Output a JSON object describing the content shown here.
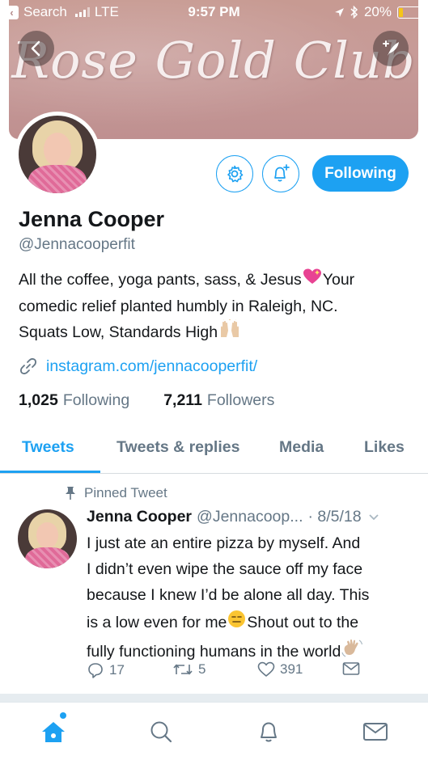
{
  "status_bar": {
    "back_app": "Search",
    "carrier": "LTE",
    "time": "9:57 PM",
    "battery": "20%",
    "battery_level": 0.2
  },
  "header": {
    "banner_text": "Rose Gold Club",
    "back_icon": "chevron-left-icon",
    "compose_icon": "compose-tweet-icon"
  },
  "profile": {
    "name": "Jenna Cooper",
    "handle": "@Jennacooperfit",
    "bio_line1_a": "All the coffee, yoga pants, sass, & Jesus",
    "bio_line1_b": "Your",
    "bio_line2": "comedic relief planted humbly in Raleigh, NC.",
    "bio_line3": "Squats Low, Standards High",
    "website": "instagram.com/jennacooperfit/",
    "following_count": "1,025",
    "following_label": "Following",
    "followers_count": "7,211",
    "followers_label": "Followers",
    "follow_button": "Following"
  },
  "tabs": [
    {
      "label": "Tweets",
      "active": true
    },
    {
      "label": "Tweets & replies",
      "active": false
    },
    {
      "label": "Media",
      "active": false
    },
    {
      "label": "Likes",
      "active": false
    }
  ],
  "pinned_tweet": {
    "pinned_label": "Pinned Tweet",
    "author_name": "Jenna Cooper",
    "author_handle": "@Jennacoop...",
    "date": "· 8/5/18",
    "line1": "I just ate an entire pizza by myself. And",
    "line2": "I didn’t even wipe the sauce off my face",
    "line3": "because I knew I’d be alone all day. This",
    "line4_a": "is a low even for me",
    "line4_b": "Shout out to the",
    "line5": "fully functioning humans in the world",
    "replies": "17",
    "retweets": "5",
    "likes": "391"
  },
  "colors": {
    "accent": "#1da1f2",
    "banner": "#c79a92",
    "muted_text": "#657786"
  }
}
